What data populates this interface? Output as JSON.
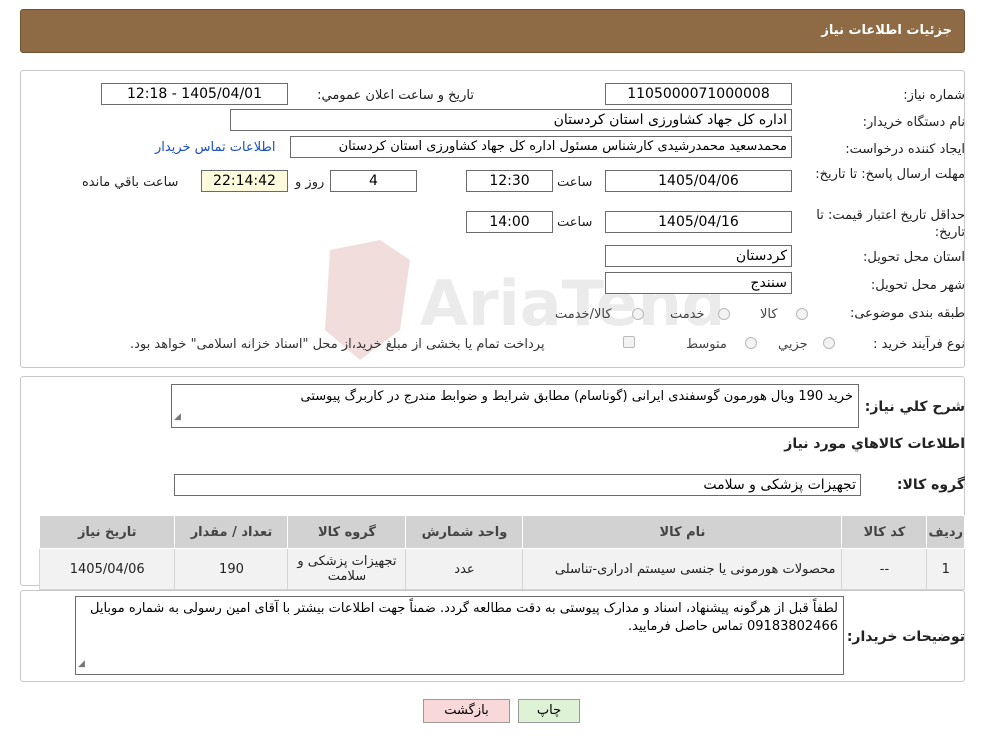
{
  "header": {
    "title": "جزئیات اطلاعات نیاز"
  },
  "form": {
    "need_number_label": "شماره نیاز:",
    "need_number": "1105000071000008",
    "announce_label": "تاریخ و ساعت اعلان عمومي:",
    "announce_value": "1405/04/01 - 12:18",
    "buyer_org_label": "نام دستگاه خريدار:",
    "buyer_org": "اداره کل جهاد کشاورزی استان کردستان",
    "creator_label": "ایجاد کننده درخواست:",
    "creator": "محمدسعید محمدرشیدی کارشناس مسئول اداره کل جهاد کشاورزی استان کردستان",
    "contact_link": "اطلاعات تماس خريدار",
    "reply_deadline_label": "مهلت ارسال پاسخ: تا تاریخ:",
    "reply_date": "1405/04/06",
    "time_label": "ساعت",
    "reply_time": "12:30",
    "days_value": "4",
    "days_label": "روز و",
    "remaining_time": "22:14:42",
    "remaining_label": "ساعت باقي مانده",
    "price_validity_label": "حداقل تاریخ اعتبار قیمت: تا تاریخ:",
    "price_date": "1405/04/16",
    "price_time": "14:00",
    "province_label": "استان محل تحويل:",
    "province": "کردستان",
    "city_label": "شهر محل تحويل:",
    "city": "سنندج",
    "category_label": "طبقه بندی موضوعی:",
    "category_options": [
      "کالا",
      "خدمت",
      "کالا/خدمت"
    ],
    "process_label": "نوع فرآیند خرید :",
    "process_options": [
      "جزیي",
      "متوسط"
    ],
    "treasury_note": "پرداخت تمام يا بخشی از مبلغ خريد،از محل \"اسناد خزانه اسلامی\" خواهد بود."
  },
  "details": {
    "description_label": "شرح کلي نياز:",
    "description": "خرید 190 ویال هورمون گوسفندی ایرانی (گوناسام) مطابق شرایط و ضوابط مندرج در کاربرگ پیوستی",
    "goods_info_title": "اطلاعات کالاهاي مورد نياز",
    "goods_group_label": "گروه کالا:",
    "goods_group": "تجهیزات پزشکی و سلامت"
  },
  "table": {
    "headers": [
      "رديف",
      "کد کالا",
      "نام کالا",
      "واحد شمارش",
      "گروه کالا",
      "تعداد / مقدار",
      "تاريخ نياز"
    ],
    "rows": [
      [
        "1",
        "--",
        "محصولات هورمونی یا جنسی سیستم ادراری-تناسلی",
        "عدد",
        "تجهیزات پزشکی و سلامت",
        "190",
        "1405/04/06"
      ]
    ]
  },
  "buyer_notes": {
    "label": "توضيحات خريدار:",
    "text": "لطفاً قبل از هرگونه پیشنهاد، اسناد و مدارک پیوستی به دقت مطالعه گردد. ضمناً جهت اطلاعات بیشتر با آقای امین رسولی به شماره موبایل   09183802466 تماس حاصل فرمایید."
  },
  "buttons": {
    "print": "چاپ",
    "back": "بازگشت"
  },
  "watermark": {
    "text": "AriaTender.neT"
  },
  "colors": {
    "header_bg": "#8e6b45",
    "link": "#1a4ec2",
    "timer_bg": "#fdfbdc",
    "back_btn": "#f8d8d8",
    "print_btn": "#def3d6"
  }
}
